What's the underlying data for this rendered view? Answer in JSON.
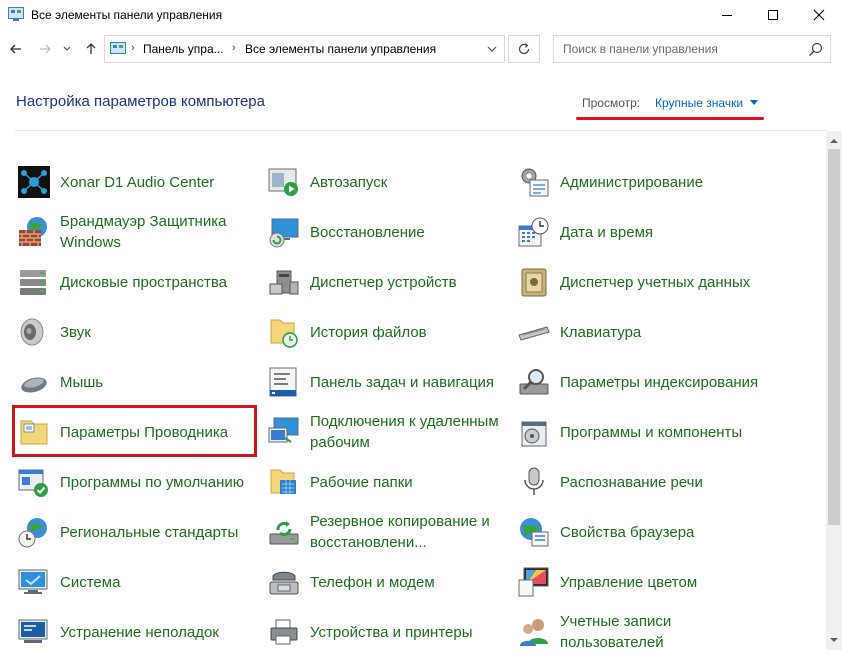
{
  "window": {
    "title": "Все элементы панели управления"
  },
  "address": {
    "segments": [
      "Панель упра...",
      "Все элементы панели управления"
    ]
  },
  "search": {
    "placeholder": "Поиск в панели управления"
  },
  "header": {
    "title": "Настройка параметров компьютера",
    "view_label": "Просмотр:",
    "view_value": "Крупные значки"
  },
  "colors": {
    "item_text": "#1f6d1f",
    "title_text": "#1e3287",
    "link": "#0066cc",
    "highlight": "#d2141c"
  },
  "items": {
    "col1": [
      {
        "label": "Xonar D1 Audio Center",
        "icon": "audio-center-icon"
      },
      {
        "label": "Брандмауэр Защитника Windows",
        "icon": "firewall-icon"
      },
      {
        "label": "Дисковые пространства",
        "icon": "storage-spaces-icon"
      },
      {
        "label": "Звук",
        "icon": "speaker-icon"
      },
      {
        "label": "Мышь",
        "icon": "mouse-icon"
      },
      {
        "label": "Параметры Проводника",
        "icon": "folder-options-icon"
      },
      {
        "label": "Программы по умолчанию",
        "icon": "default-programs-icon"
      },
      {
        "label": "Региональные стандарты",
        "icon": "region-icon"
      },
      {
        "label": "Система",
        "icon": "system-icon"
      },
      {
        "label": "Устранение неполадок",
        "icon": "troubleshooting-icon"
      }
    ],
    "col2": [
      {
        "label": "Автозапуск",
        "icon": "autoplay-icon"
      },
      {
        "label": "Восстановление",
        "icon": "recovery-icon"
      },
      {
        "label": "Диспетчер устройств",
        "icon": "device-manager-icon"
      },
      {
        "label": "История файлов",
        "icon": "file-history-icon"
      },
      {
        "label": "Панель задач и навигация",
        "icon": "taskbar-icon"
      },
      {
        "label": "Подключения к удаленным рабочим",
        "icon": "remoteapp-icon"
      },
      {
        "label": "Рабочие папки",
        "icon": "work-folders-icon"
      },
      {
        "label": "Резервное копирование и восстановлени...",
        "icon": "backup-icon"
      },
      {
        "label": "Телефон и модем",
        "icon": "phone-modem-icon"
      },
      {
        "label": "Устройства и принтеры",
        "icon": "devices-printers-icon"
      }
    ],
    "col3": [
      {
        "label": "Администрирование",
        "icon": "admin-tools-icon"
      },
      {
        "label": "Дата и время",
        "icon": "date-time-icon"
      },
      {
        "label": "Диспетчер учетных данных",
        "icon": "credential-manager-icon"
      },
      {
        "label": "Клавиатура",
        "icon": "keyboard-icon"
      },
      {
        "label": "Параметры индексирования",
        "icon": "indexing-icon"
      },
      {
        "label": "Программы и компоненты",
        "icon": "programs-features-icon"
      },
      {
        "label": "Распознавание речи",
        "icon": "microphone-icon"
      },
      {
        "label": "Свойства браузера",
        "icon": "internet-options-icon"
      },
      {
        "label": "Управление цветом",
        "icon": "color-management-icon"
      },
      {
        "label": "Учетные записи пользователей",
        "icon": "user-accounts-icon"
      }
    ]
  }
}
